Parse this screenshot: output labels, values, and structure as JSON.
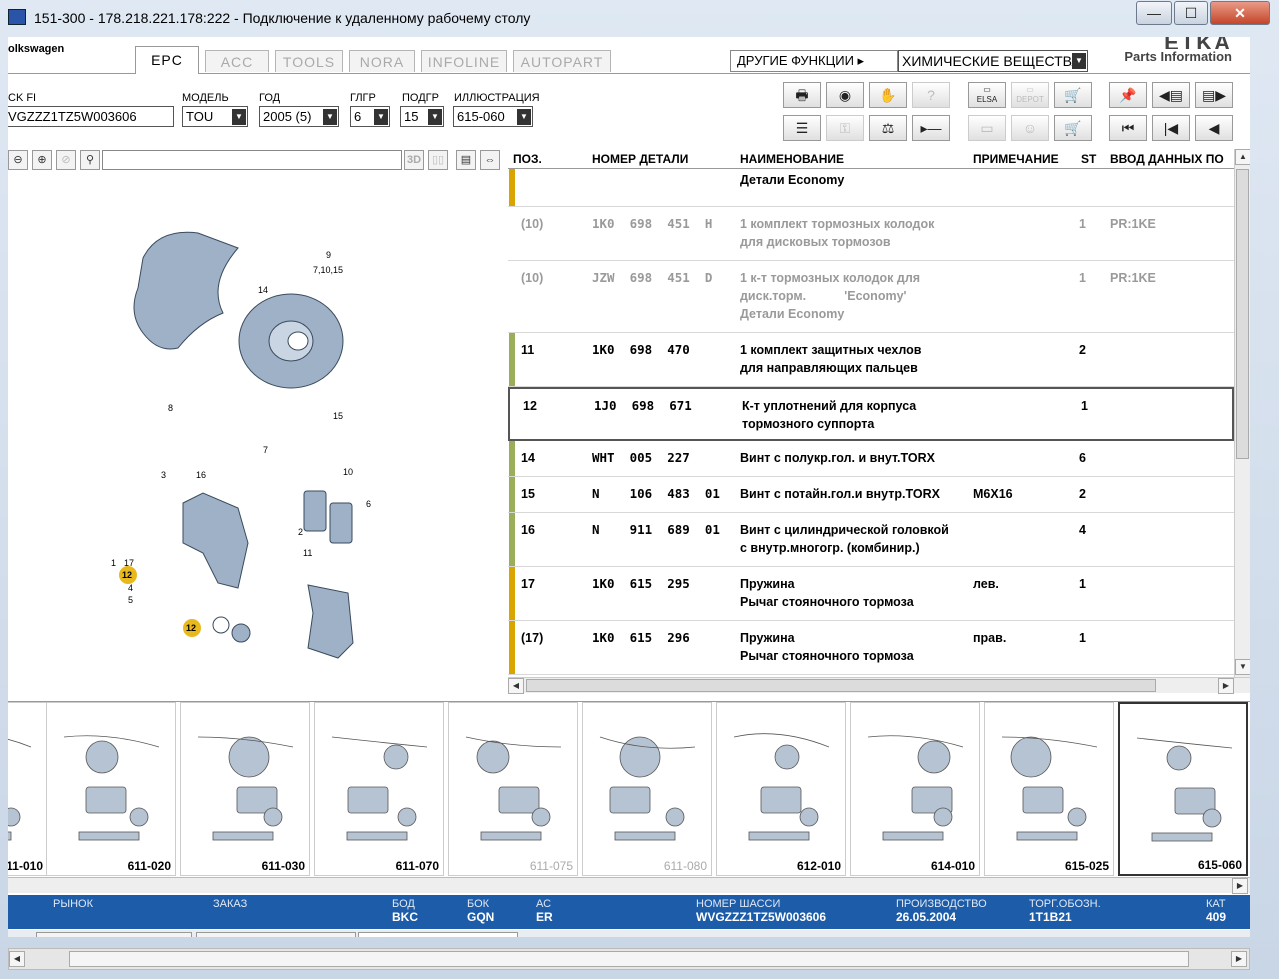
{
  "window": {
    "title": "151-300 - 178.218.221.178:222 - Подключение к удаленному рабочему столу",
    "min_label": "—",
    "max_label": "☐",
    "close_label": "✕"
  },
  "brand": "olkswagen",
  "etka": {
    "logo": "ETKA",
    "subtitle": "Parts Information"
  },
  "tabs": [
    "EPC",
    "ACC",
    "TOOLS",
    "NORA",
    "INFOLINE",
    "AUTOPART"
  ],
  "other_functions": "ДРУГИЕ ФУНКЦИИ ▸",
  "chemicals_select": "ХИМИЧЕСКИЕ ВЕЩЕСТВА",
  "selectors": [
    {
      "label": "CK FI",
      "value": "VGZZZ1TZ5W003606"
    },
    {
      "label": "МОДЕЛЬ",
      "value": "TOU"
    },
    {
      "label": "ГОД",
      "value": "2005 (5)"
    },
    {
      "label": "ГЛГР",
      "value": "6"
    },
    {
      "label": "ПОДГР",
      "value": "15"
    },
    {
      "label": "ИЛЛЮСТРАЦИЯ",
      "value": "615-060"
    }
  ],
  "toolbar_icons": {
    "row1": [
      "print-icon",
      "disc-icon",
      "handshake-icon",
      "chat-icon",
      "elsa-icon",
      "depot-icon",
      "cart-icon",
      "pin-icon",
      "prev-page-icon",
      "next-page-icon"
    ],
    "row2": [
      "list-icon",
      "key-icon",
      "scale-icon",
      "minus-icon",
      "monitor-icon",
      "chat-user-icon",
      "cart-full-icon",
      "first-icon",
      "prev-icon",
      "back-icon"
    ]
  },
  "toolbar_labels": {
    "elsa": "ELSA",
    "depot": "DEPOT"
  },
  "illu_tools": {
    "label_3d": "3D"
  },
  "table": {
    "headers": [
      "ПОЗ.",
      "НОМЕР ДЕТАЛИ",
      "НАИМЕНОВАНИЕ",
      "ПРИМЕЧАНИЕ",
      "ST",
      "ВВОД ДАННЫХ ПО"
    ],
    "rows": [
      {
        "pos": "",
        "part": "",
        "name": "Детали Economy",
        "note": "",
        "st": "",
        "input": "",
        "bar": "#d9a400",
        "grey": false
      },
      {
        "pos": "(10)",
        "part": "1K0  698  451  H",
        "name": "1 комплект тормозных колодок\nдля дисковых тормозов",
        "note": "",
        "st": "1",
        "input": "PR:1KE",
        "bar": "",
        "grey": true
      },
      {
        "pos": "(10)",
        "part": "JZW  698  451  D",
        "name": "1 к-т тормозных колодок для\nдиск.торм.           'Economy'\nДетали Economy",
        "note": "",
        "st": "1",
        "input": "PR:1KE",
        "bar": "",
        "grey": true
      },
      {
        "pos": "11",
        "part": "1K0  698  470",
        "name": "1 комплект защитных чехлов\nдля направляющих пальцев",
        "note": "",
        "st": "2",
        "input": "",
        "bar": "#9aae5a",
        "grey": false
      },
      {
        "pos": "12",
        "part": "1J0  698  671",
        "name": "К-т уплотнений для корпуса\nтормозного суппорта",
        "note": "",
        "st": "1",
        "input": "",
        "bar": "",
        "grey": false
      },
      {
        "pos": "14",
        "part": "WHT  005  227",
        "name": "Винт с полукр.гол. и внут.TORX",
        "note": "",
        "st": "6",
        "input": "",
        "bar": "#9aae5a",
        "grey": false
      },
      {
        "pos": "15",
        "part": "N    106  483  01",
        "name": "Винт с потайн.гол.и внутр.TORX",
        "note": "M6X16",
        "st": "2",
        "input": "",
        "bar": "#9aae5a",
        "grey": false
      },
      {
        "pos": "16",
        "part": "N    911  689  01",
        "name": "Винт с цилиндрической головкой\nс внутр.многогр. (комбинир.)",
        "note": "",
        "st": "4",
        "input": "",
        "bar": "#9aae5a",
        "grey": false
      },
      {
        "pos": "17",
        "part": "1K0  615  295",
        "name": "Пружина\nРычаг стояночного тормоза",
        "note": "лев.",
        "st": "1",
        "input": "",
        "bar": "#d9a400",
        "grey": false
      },
      {
        "pos": "(17)",
        "part": "1K0  615  296",
        "name": "Пружина\nРычаг стояночного тормоза",
        "note": "прав.",
        "st": "1",
        "input": "",
        "bar": "#d9a400",
        "grey": false
      }
    ]
  },
  "diagram_labels": [
    "9",
    "7,10,15",
    "14",
    "8",
    "15",
    "7",
    "3",
    "16",
    "10",
    "6",
    "2",
    "11",
    "1",
    "17",
    "12",
    "4",
    "5",
    "12"
  ],
  "thumbnails": [
    {
      "label": "11-010",
      "grey": false
    },
    {
      "label": "611-020",
      "grey": false
    },
    {
      "label": "611-030",
      "grey": false
    },
    {
      "label": "611-070",
      "grey": false
    },
    {
      "label": "611-075",
      "grey": true
    },
    {
      "label": "611-080",
      "grey": true
    },
    {
      "label": "612-010",
      "grey": false
    },
    {
      "label": "614-010",
      "grey": false
    },
    {
      "label": "615-025",
      "grey": false
    },
    {
      "label": "615-060",
      "grey": false
    }
  ],
  "status": [
    {
      "label": "РЫНОК",
      "value": ""
    },
    {
      "label": "ЗАКАЗ",
      "value": ""
    },
    {
      "label": "БОД",
      "value": "BKC"
    },
    {
      "label": "БОК",
      "value": "GQN"
    },
    {
      "label": "АС",
      "value": "ER"
    },
    {
      "label": "НОМЕР ШАССИ",
      "value": "WVGZZZ1TZ5W003606"
    },
    {
      "label": "ПРОИЗВОДСТВО",
      "value": "26.05.2004"
    },
    {
      "label": "ТОРГ.ОБОЗН.",
      "value": "1T1B21"
    },
    {
      "label": "КАТ",
      "value": "409"
    }
  ],
  "colors": {
    "status_bar": "#1d5ca8",
    "accent_yellow": "#d9a400",
    "accent_green": "#9aae5a",
    "callout": "#e8b81c"
  }
}
